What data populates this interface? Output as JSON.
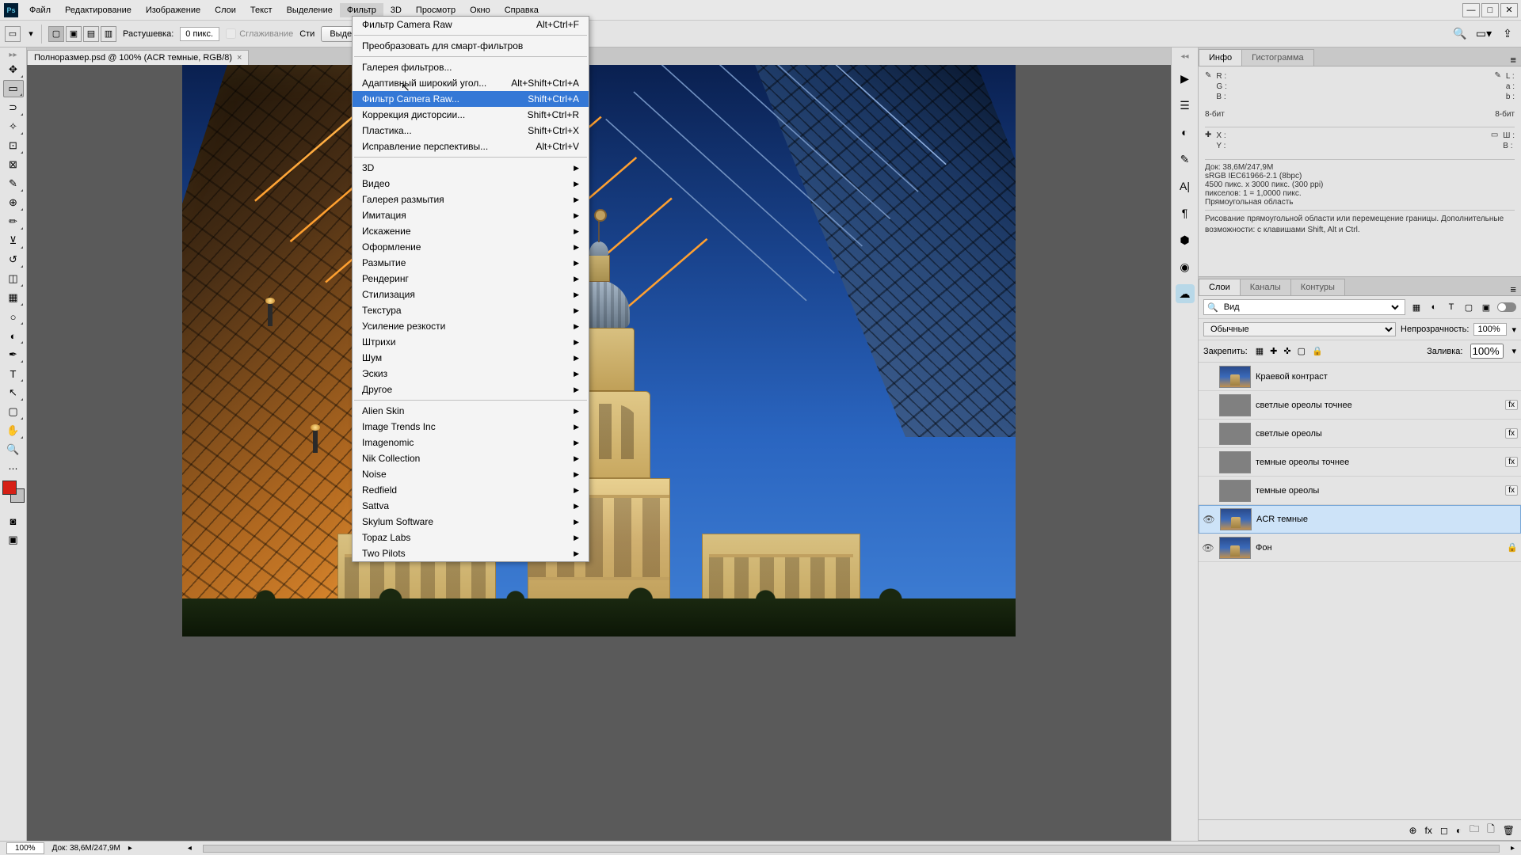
{
  "menubar": [
    "Файл",
    "Редактирование",
    "Изображение",
    "Слои",
    "Текст",
    "Выделение",
    "Фильтр",
    "3D",
    "Просмотр",
    "Окно",
    "Справка"
  ],
  "activeMenu": 6,
  "options": {
    "feather_label": "Растушевка:",
    "feather_value": "0 пикс.",
    "antialias": "Сглаживание",
    "style_label": "Сти",
    "select_mask": "Выделение и маска..."
  },
  "doc_tab": "Полноразмер.psd @ 100% (ACR темные, RGB/8)",
  "status": {
    "zoom": "100%",
    "doc": "Док: 38,6M/247,9M"
  },
  "dropdown": {
    "sec1": [
      {
        "label": "Фильтр Camera Raw",
        "shortcut": "Alt+Ctrl+F"
      }
    ],
    "sec2": [
      {
        "label": "Преобразовать для смарт-фильтров"
      }
    ],
    "sec3": [
      {
        "label": "Галерея фильтров..."
      },
      {
        "label": "Адаптивный широкий угол...",
        "shortcut": "Alt+Shift+Ctrl+A"
      },
      {
        "label": "Фильтр Camera Raw...",
        "shortcut": "Shift+Ctrl+A",
        "hl": true
      },
      {
        "label": "Коррекция дисторсии...",
        "shortcut": "Shift+Ctrl+R"
      },
      {
        "label": "Пластика...",
        "shortcut": "Shift+Ctrl+X"
      },
      {
        "label": "Исправление перспективы...",
        "shortcut": "Alt+Ctrl+V"
      }
    ],
    "sec4": [
      {
        "label": "3D",
        "sub": true
      },
      {
        "label": "Видео",
        "sub": true
      },
      {
        "label": "Галерея размытия",
        "sub": true
      },
      {
        "label": "Имитация",
        "sub": true
      },
      {
        "label": "Искажение",
        "sub": true
      },
      {
        "label": "Оформление",
        "sub": true
      },
      {
        "label": "Размытие",
        "sub": true
      },
      {
        "label": "Рендеринг",
        "sub": true
      },
      {
        "label": "Стилизация",
        "sub": true
      },
      {
        "label": "Текстура",
        "sub": true
      },
      {
        "label": "Усиление резкости",
        "sub": true
      },
      {
        "label": "Штрихи",
        "sub": true
      },
      {
        "label": "Шум",
        "sub": true
      },
      {
        "label": "Эскиз",
        "sub": true
      },
      {
        "label": "Другое",
        "sub": true
      }
    ],
    "sec5": [
      {
        "label": "Alien Skin",
        "sub": true
      },
      {
        "label": "Image Trends Inc",
        "sub": true
      },
      {
        "label": "Imagenomic",
        "sub": true
      },
      {
        "label": "Nik Collection",
        "sub": true
      },
      {
        "label": "Noise",
        "sub": true
      },
      {
        "label": "Redfield",
        "sub": true
      },
      {
        "label": "Sattva",
        "sub": true
      },
      {
        "label": "Skylum Software",
        "sub": true
      },
      {
        "label": "Topaz Labs",
        "sub": true
      },
      {
        "label": "Two Pilots",
        "sub": true
      }
    ]
  },
  "info": {
    "tab1": "Инфо",
    "tab2": "Гистограмма",
    "r": "R :",
    "g": "G :",
    "b": "B :",
    "l": "L :",
    "a": "a :",
    "b2": "b :",
    "bits": "8-бит",
    "x": "X :",
    "y": "Y :",
    "w": "Ш :",
    "h": "В :",
    "doc": "Док: 38,6M/247,9M",
    "line1": "sRGB IEC61966-2.1 (8bpc)",
    "line2": "4500 пикс. x 3000 пикс. (300 ppi)",
    "line3": "пикселов: 1 = 1,0000 пикс.",
    "line4": "Прямоугольная область",
    "hint": "Рисование прямоугольной области или перемещение границы.  Дополнительные возможности: с клавишами Shift, Alt и Ctrl."
  },
  "layers": {
    "tab1": "Слои",
    "tab2": "Каналы",
    "tab3": "Контуры",
    "kind": "Вид",
    "blend": "Обычные",
    "opacity_label": "Непрозрачность:",
    "opacity": "100%",
    "lock_label": "Закрепить:",
    "fill_label": "Заливка:",
    "fill": "100%",
    "items": [
      {
        "name": "Краевой контраст",
        "vis": false,
        "thumb": "img"
      },
      {
        "name": "светлые ореолы точнее",
        "vis": false,
        "thumb": "gray",
        "fx": true
      },
      {
        "name": "светлые ореолы",
        "vis": false,
        "thumb": "gray",
        "fx": true
      },
      {
        "name": "темные ореолы точнее",
        "vis": false,
        "thumb": "gray",
        "fx": true
      },
      {
        "name": "темные ореолы",
        "vis": false,
        "thumb": "gray",
        "fx": true
      },
      {
        "name": "ACR темные",
        "vis": true,
        "thumb": "img",
        "sel": true
      },
      {
        "name": "Фон",
        "vis": true,
        "thumb": "img",
        "lock": true
      }
    ]
  }
}
